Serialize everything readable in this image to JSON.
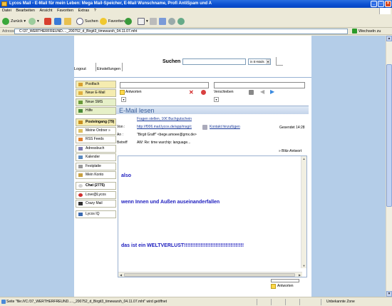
{
  "window": {
    "title": "Lycos Mail - E-Mail für mein Leben: Mega Mail-Speicher, E-Mail Wunschname, Profi AntiSpam und A",
    "minimize": "_",
    "maximize": "□",
    "close": "×"
  },
  "menu": [
    "Datei",
    "Bearbeiten",
    "Ansicht",
    "Favoriten",
    "Extras",
    "?"
  ],
  "toolbar": {
    "back": "Zurück",
    "search": "Suchen",
    "favorites": "Favoriten"
  },
  "address": {
    "label": "Adresse",
    "url": "C:\\37_WERTHERFREUND...._200752_d_Birgit3_timewarsh_04.11.07.mht",
    "go_label": "Wechseln zu"
  },
  "header": {
    "logout": "Logout",
    "settings": "Einstellungen",
    "search_label": "Suchen",
    "search_placeholder": "",
    "search_scope": "in E-Mails"
  },
  "sidebar": {
    "items": [
      {
        "label": "Postfach",
        "icon": "mailbox-icon"
      },
      {
        "label": "Neue E-Mail",
        "icon": "new-mail-icon"
      },
      {
        "label": "Neue SMS",
        "icon": "sms-icon"
      },
      {
        "label": "Hilfe",
        "icon": "help-icon"
      },
      {
        "label": "Posteingang (79)",
        "icon": "inbox-icon"
      },
      {
        "label": "Meine Ordner »",
        "icon": "folder-icon"
      },
      {
        "label": "RSS Feeds",
        "icon": "rss-icon"
      },
      {
        "label": "Adressbuch",
        "icon": "addressbook-icon"
      },
      {
        "label": "Kalender",
        "icon": "calendar-icon"
      },
      {
        "label": "Festplatte",
        "icon": "harddisk-icon"
      },
      {
        "label": "Mein Konto",
        "icon": "account-icon"
      },
      {
        "label": "Chat (2775)",
        "icon": "chat-icon"
      },
      {
        "label": "Love@Lycos",
        "icon": "love-icon"
      },
      {
        "label": "Crazy Mail",
        "icon": "crazymail-icon"
      },
      {
        "label": "Lycos IQ",
        "icon": "lycos-iq-icon"
      }
    ]
  },
  "actions": {
    "reply": "Antworten",
    "move": "Verschieben"
  },
  "mail": {
    "title": "E-Mail lesen",
    "ad_link": "Fragen stellen, 10€ Buchgutschein",
    "from_label": "Von :",
    "from_value": "http://f006.mail.lycos.de/app/msg/c",
    "add_contact": "Kontakt hinzufügen",
    "sent": "Gesendet  14:28",
    "to_label": "An :",
    "to_value": "\"Birgit Graff\" <bege.amoee@gmx.de>",
    "subject_label": "Betreff",
    "subject_value": "AW: Re: time warchip: language...",
    "quick_reply": "» Blitz-Antwort",
    "body": {
      "line1": "also",
      "line2": "wenn Innen und Außen auseinanderfallen",
      "line3": "das ist ein WELTVERLUST!!!!!!!!!!!!!!!!!!!!!!!!!!!!!!!!!!!!"
    },
    "bottom_reply": "Antworten"
  },
  "status": {
    "text": "Seite \"file:///C:/37_WERTHERFREUND....._200752_d_Birgit3_timewarsh_04.11.07.mht\" wird geöffnet",
    "zone": "Unbekannte Zone"
  }
}
